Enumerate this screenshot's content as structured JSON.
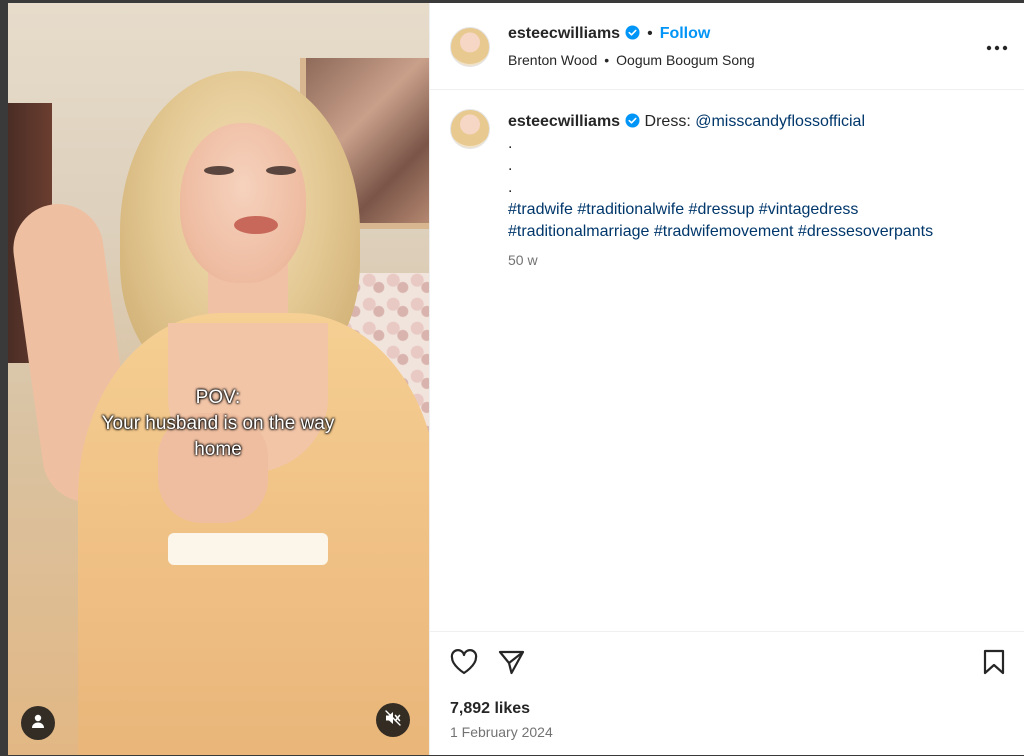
{
  "post": {
    "username": "esteecwilliams",
    "follow_label": "Follow",
    "separator": "•",
    "audio": {
      "artist": "Brenton Wood",
      "song": "Oogum Boogum Song"
    },
    "caption": {
      "username": "esteecwilliams",
      "prefix": "Dress:",
      "mention": "@misscandyflossofficial",
      "dots": [
        ".",
        ".",
        "."
      ],
      "hashtags_line1": "#tradwife #traditionalwife #dressup #vintagedress",
      "hashtags_line2": "#traditionalmarriage #tradwifemovement #dressesoverpants",
      "time_ago": "50 w"
    },
    "likes": "7,892 likes",
    "date": "1 February 2024"
  },
  "video": {
    "overlay_lines": [
      "POV:",
      "Your husband is on the way",
      "home"
    ]
  },
  "colors": {
    "accent": "#0095f6",
    "link": "#00376b",
    "verified": "#0095f6",
    "muted_text": "#737373"
  },
  "icons": {
    "verified": "verified-badge-icon",
    "more": "more-horizontal-icon",
    "like": "heart-icon",
    "share": "paper-plane-icon",
    "save": "bookmark-icon",
    "tagged_user": "user-icon",
    "mute": "speaker-muted-icon"
  }
}
